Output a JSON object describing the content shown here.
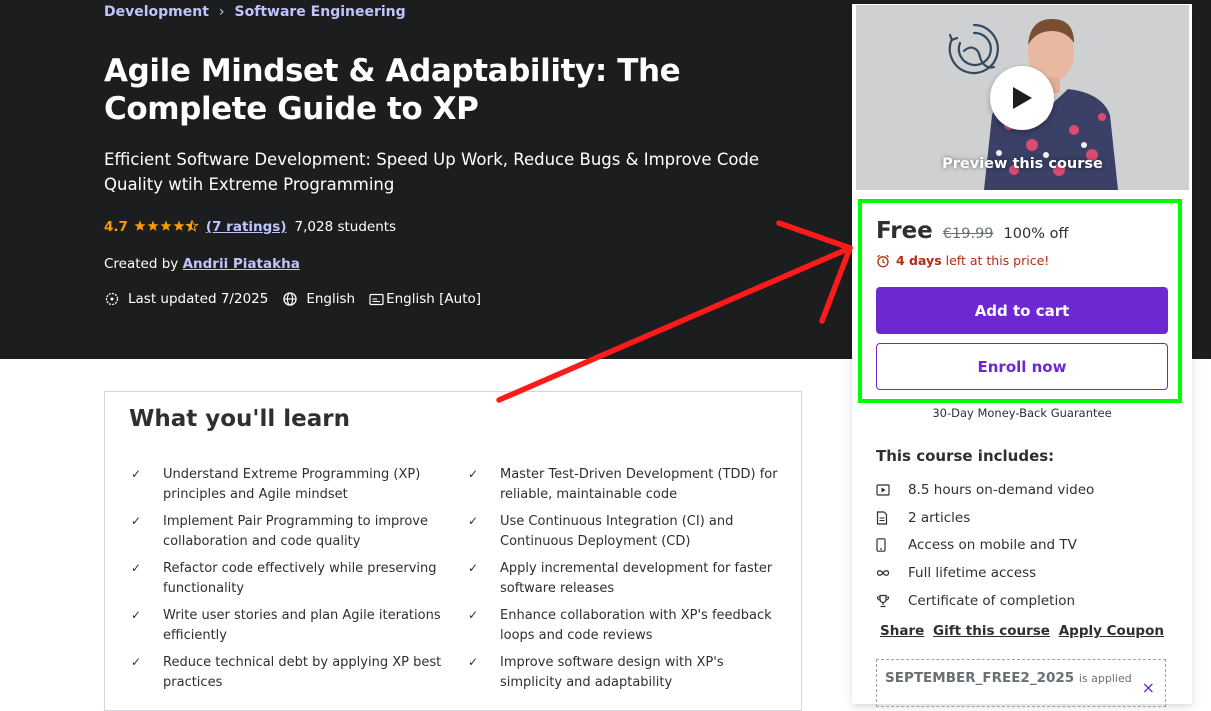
{
  "breadcrumbs": [
    "Development",
    "Software Engineering"
  ],
  "breadcrumb_sep": "›",
  "course": {
    "title": "Agile Mindset & Adaptability: The Complete Guide to XP",
    "subtitle": "Efficient Software Development: Speed Up Work, Reduce Bugs & Improve Code Quality wtih Extreme Programming",
    "rating": "4.7",
    "rating_value": 4.7,
    "ratings_link": "(7 ratings)",
    "students": "7,028 students",
    "created_by_label": "Created by",
    "instructor": "Andrii Piatakha",
    "last_updated": "Last updated 7/2025",
    "language": "English",
    "captions": "English [Auto]"
  },
  "learn": {
    "heading": "What you'll learn",
    "check_glyph": "✓",
    "items": [
      "Understand Extreme Programming (XP) principles and Agile mindset",
      "Master Test-Driven Development (TDD) for reliable, maintainable code",
      "Implement Pair Programming to improve collaboration and code quality",
      "Use Continuous Integration (CI) and Continuous Deployment (CD)",
      "Refactor code effectively while preserving functionality",
      "Apply incremental development for faster software releases",
      "Write user stories and plan Agile iterations efficiently",
      "Enhance collaboration with XP's feedback loops and code reviews",
      "Reduce technical debt by applying XP best practices",
      "Improve software design with XP's simplicity and adaptability"
    ]
  },
  "sidebar": {
    "preview_label": "Preview this course",
    "price": "Free",
    "original_price": "€19.99",
    "discount": "100% off",
    "timer_bold": "4 days",
    "timer_rest": "left at this price!",
    "add_to_cart": "Add to cart",
    "enroll_now": "Enroll now",
    "guarantee": "30-Day Money-Back Guarantee",
    "includes_title": "This course includes:",
    "includes": [
      {
        "icon": "video-icon",
        "text": "8.5 hours on-demand video"
      },
      {
        "icon": "article-icon",
        "text": "2 articles"
      },
      {
        "icon": "mobile-icon",
        "text": "Access on mobile and TV"
      },
      {
        "icon": "infinity-icon",
        "text": "Full lifetime access"
      },
      {
        "icon": "trophy-icon",
        "text": "Certificate of completion"
      }
    ],
    "share": "Share",
    "gift": "Gift this course",
    "apply_coupon": "Apply Coupon",
    "coupon_code": "SEPTEMBER_FREE2_2025",
    "coupon_applied": "is applied",
    "coupon_remove": "×"
  },
  "colors": {
    "accent": "#6d28d2",
    "hero_bg": "#1c1d1f",
    "star": "#f69c08",
    "link": "#c0c4fc",
    "timer": "#b32d0f",
    "annotation_box": "#00ff00",
    "annotation_arrow": "#ff0000"
  }
}
